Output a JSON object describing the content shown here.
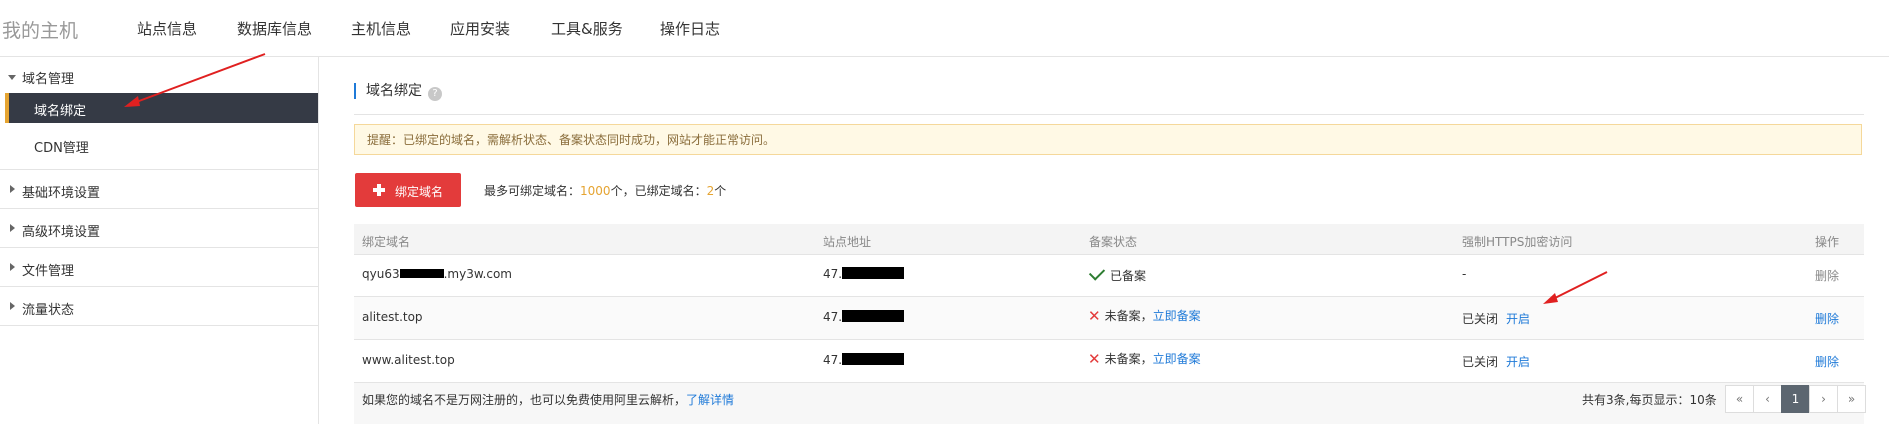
{
  "header": {
    "brand": "我的主机",
    "nav": [
      "站点信息",
      "数据库信息",
      "主机信息",
      "应用安装",
      "工具&服务",
      "操作日志"
    ]
  },
  "sidebar": {
    "group_domain": "域名管理",
    "item_bind": "域名绑定",
    "item_cdn": "CDN管理",
    "group_basic": "基础环境设置",
    "group_advanced": "高级环境设置",
    "group_files": "文件管理",
    "group_traffic": "流量状态"
  },
  "main": {
    "title": "域名绑定",
    "help_glyph": "?",
    "notice": "提醒：已绑定的域名，需解析状态、备案状态同时成功，网站才能正常访问。",
    "add_button": "绑定域名",
    "quota_prefix": "最多可绑定域名：",
    "quota_max": "1000",
    "quota_mid": "个，已绑定域名：",
    "quota_bound": "2",
    "quota_suffix": "个"
  },
  "table": {
    "headers": [
      "绑定域名",
      "站点地址",
      "备案状态",
      "强制HTTPS加密访问",
      "操作"
    ],
    "rows": [
      {
        "domain_prefix": "qyu63",
        "domain_suffix": ".my3w.com",
        "ip_prefix": "47.",
        "record": "已备案",
        "record_link": "",
        "https_status": "-",
        "https_action": "",
        "op": "删除"
      },
      {
        "domain_prefix": "alitest.top",
        "domain_suffix": "",
        "ip_prefix": "47.",
        "record": "未备案，",
        "record_link": "立即备案",
        "https_status": "已关闭",
        "https_action": "开启",
        "op": "删除"
      },
      {
        "domain_prefix": "www.alitest.top",
        "domain_suffix": "",
        "ip_prefix": "47.",
        "record": "未备案，",
        "record_link": "立即备案",
        "https_status": "已关闭",
        "https_action": "开启",
        "op": "删除"
      }
    ]
  },
  "footer": {
    "note": "如果您的域名不是万网注册的，也可以免费使用阿里云解析，",
    "note_link": "了解详情",
    "pager_info": "共有3条,每页显示：10条",
    "pager": {
      "first": "«",
      "prev": "‹",
      "current": "1",
      "next": "›",
      "last": "»"
    }
  },
  "colors": {
    "accent": "#1f7ad8",
    "danger": "#e33b3b",
    "sidebar_active": "#353a45",
    "highlight": "#e5a432"
  }
}
